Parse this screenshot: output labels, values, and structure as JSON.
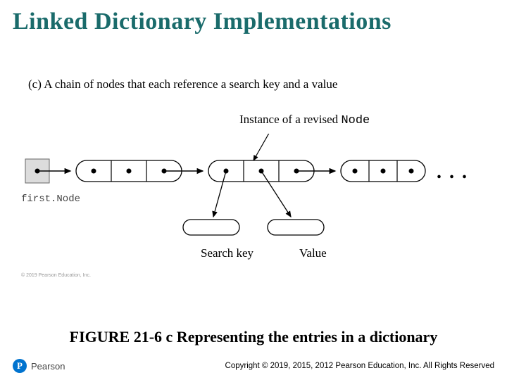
{
  "title": "Linked Dictionary Implementations",
  "sub_caption_prefix": "(c) ",
  "sub_caption": "A chain of nodes that each reference a search key and a value",
  "instance_label_prefix": "Instance of a revised ",
  "instance_label_mono": "Node",
  "first_node": "first.Node",
  "search_key": "Search key",
  "value": "Value",
  "ellipsis": ". . .",
  "tiny_copyright": "© 2019 Pearson Education, Inc.",
  "figure_caption": "FIGURE 21-6 c Representing the entries in a dictionary",
  "brand_letter": "P",
  "brand_name": "Pearson",
  "footer_copyright": "Copyright © 2019, 2015, 2012 Pearson Education, Inc. All Rights Reserved"
}
